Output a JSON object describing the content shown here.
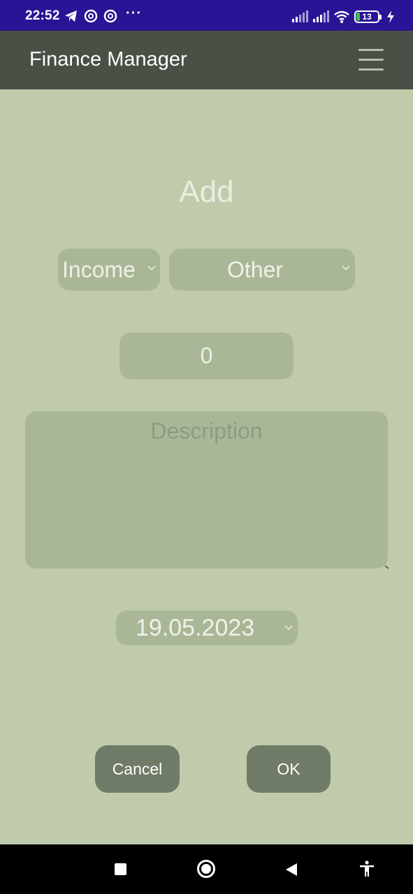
{
  "status_bar": {
    "time": "22:52",
    "icons_left": [
      "telegram-icon",
      "at-sign-icon",
      "at-sign-icon",
      "more-dots-icon"
    ],
    "dots": "···",
    "battery_level": "13",
    "icons_right": [
      "signal-icon",
      "signal-icon",
      "wifi-icon",
      "battery-icon",
      "charging-icon"
    ]
  },
  "app_bar": {
    "title": "Finance Manager",
    "menu_icon": "hamburger-menu-icon"
  },
  "form": {
    "heading": "Add",
    "type_select": {
      "value": "Income"
    },
    "category_select": {
      "value": "Other"
    },
    "amount": {
      "value": "0"
    },
    "description": {
      "value": "",
      "placeholder": "Description"
    },
    "date_select": {
      "value": "19.05.2023"
    }
  },
  "buttons": {
    "cancel": "Cancel",
    "ok": "OK"
  },
  "nav_bar": {
    "icons": [
      "recents-square-icon",
      "home-circle-icon",
      "back-triangle-icon",
      "accessibility-icon"
    ]
  },
  "colors": {
    "status_bar_bg": "#2b1396",
    "app_bar_bg": "#4a5045",
    "page_bg": "#c0cbab",
    "field_bg": "#aab796",
    "button_bg": "#707b67"
  }
}
